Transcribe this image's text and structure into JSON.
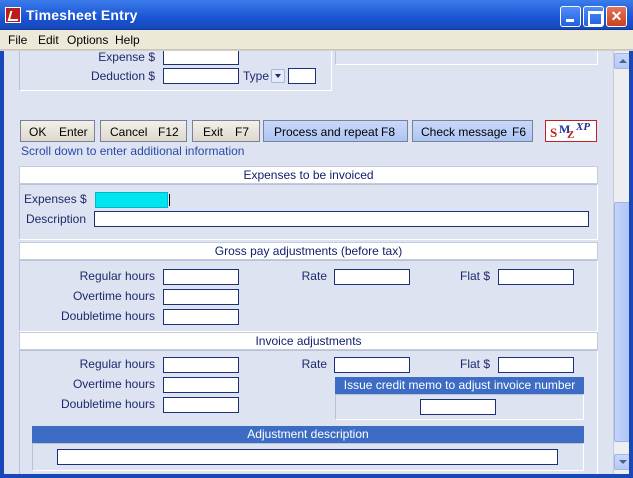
{
  "window": {
    "title": "Timesheet Entry"
  },
  "menu": [
    {
      "label": "File"
    },
    {
      "label": "Edit"
    },
    {
      "label": "Options"
    },
    {
      "label": "Help"
    }
  ],
  "top_section": {
    "expense_label": "Expense $",
    "expense_value": "",
    "deduction_label": "Deduction $",
    "deduction_value": "",
    "type_label": "Type",
    "type_value": ""
  },
  "buttons": {
    "ok": {
      "label": "OK",
      "key": "Enter"
    },
    "cancel": {
      "label": "Cancel",
      "key": "F12"
    },
    "exit": {
      "label": "Exit",
      "key": "F7"
    },
    "process": {
      "label": "Process and repeat",
      "key": "F8"
    },
    "check": {
      "label": "Check message",
      "key": "F6"
    }
  },
  "logo_text": "SMXP",
  "scroll_hint": "Scroll down to enter additional information",
  "expenses_invoiced": {
    "header": "Expenses to be invoiced",
    "expenses_label": "Expenses $",
    "expenses_value": "",
    "description_label": "Description",
    "description_value": ""
  },
  "gross_pay": {
    "header": "Gross pay adjustments  (before tax)",
    "regular_label": "Regular hours",
    "overtime_label": "Overtime hours",
    "doubletime_label": "Doubletime hours",
    "rate_label": "Rate",
    "flat_label": "Flat $"
  },
  "invoice_adj": {
    "header": "Invoice adjustments",
    "regular_label": "Regular hours",
    "overtime_label": "Overtime hours",
    "doubletime_label": "Doubletime hours",
    "rate_label": "Rate",
    "flat_label": "Flat $",
    "credit_memo_header": "Issue credit memo to adjust invoice number",
    "adjustment_desc_header": "Adjustment description"
  },
  "colors": {
    "titlebar": "#1a55d4",
    "content_bg": "#dde3f1",
    "active_field": "#00e5f0",
    "blue_header": "#3d6cc4"
  }
}
